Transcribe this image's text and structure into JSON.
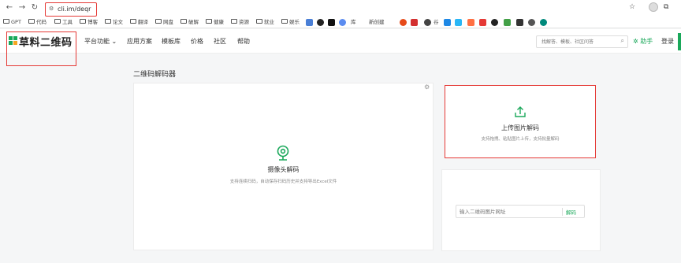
{
  "browser": {
    "url": "cli.im/deqr",
    "bookmarks": [
      "GPT",
      "代码",
      "工具",
      "博客",
      "论文",
      "翻译",
      "网盘",
      "破解",
      "健康",
      "资源",
      "就业",
      "娱乐",
      "库",
      "新创建",
      "谷"
    ]
  },
  "site": {
    "logo_text": "草料二维码",
    "nav": [
      "平台功能",
      "应用方案",
      "模板库",
      "价格",
      "社区",
      "帮助"
    ],
    "search_placeholder": "找解答、模板、社区问答",
    "helper": "助手",
    "login": "登录",
    "brand_color": "#1aa85a"
  },
  "page": {
    "title": "二维码解码器",
    "camera": {
      "title": "摄像头解码",
      "desc": "支持连续扫码，自动保存扫码历史并支持导出Excel文件"
    },
    "upload": {
      "title": "上传图片解码",
      "desc": "支持拖拽、粘贴图片上传，支持批量解码"
    },
    "url_input": {
      "placeholder": "输入二维码图片网址",
      "button": "解码"
    }
  }
}
